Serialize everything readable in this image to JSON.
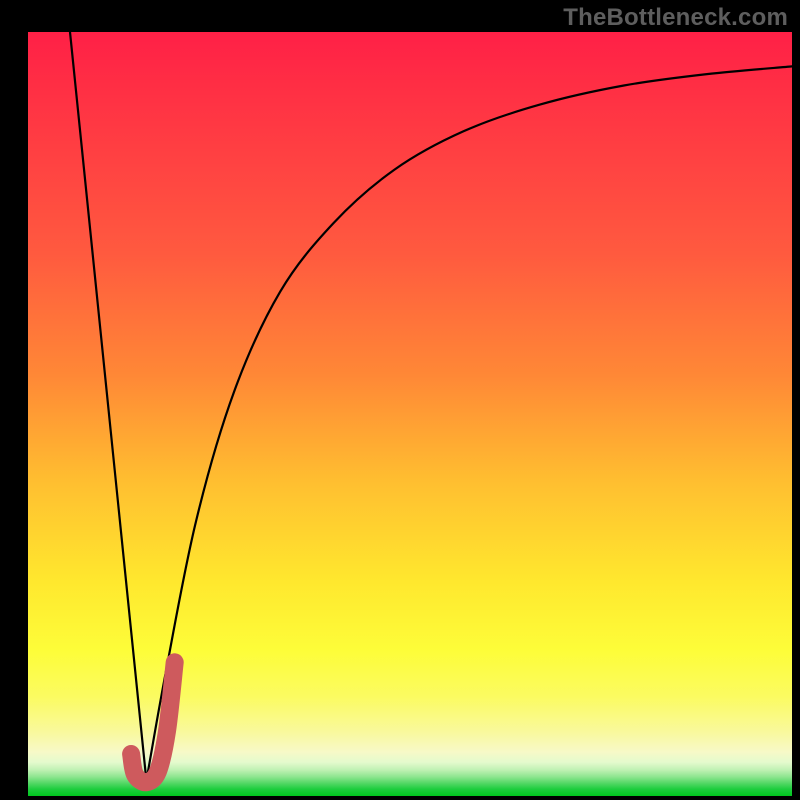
{
  "watermark": "TheBottleneck.com",
  "colors": {
    "bg_black": "#000000",
    "grad_top": "#ff2046",
    "grad_mid": "#ffe82e",
    "grad_bottom_green": "#00c81e",
    "hook_stroke": "#ce5a5d",
    "curve_stroke": "#000000",
    "watermark_text": "#5e5e5e"
  },
  "chart_data": {
    "type": "line",
    "title": "",
    "xlabel": "",
    "ylabel": "",
    "xlim": [
      0,
      100
    ],
    "ylim": [
      0,
      100
    ],
    "series": [
      {
        "name": "left-falling-edge",
        "x": [
          5.5,
          15.5
        ],
        "values": [
          100,
          2
        ]
      },
      {
        "name": "main-rising-curve",
        "x": [
          15.5,
          18,
          22,
          27,
          33,
          40,
          48,
          57,
          67,
          78,
          89,
          100
        ],
        "values": [
          2,
          16,
          36,
          53,
          66,
          75,
          82,
          87,
          90.5,
          93,
          94.5,
          95.5
        ]
      },
      {
        "name": "hook-overlay",
        "x": [
          13.5,
          14.0,
          15.5,
          17.0,
          18.2,
          19.2
        ],
        "values": [
          5.5,
          2.8,
          1.8,
          3.2,
          8.5,
          17.5
        ]
      }
    ],
    "annotations": []
  }
}
